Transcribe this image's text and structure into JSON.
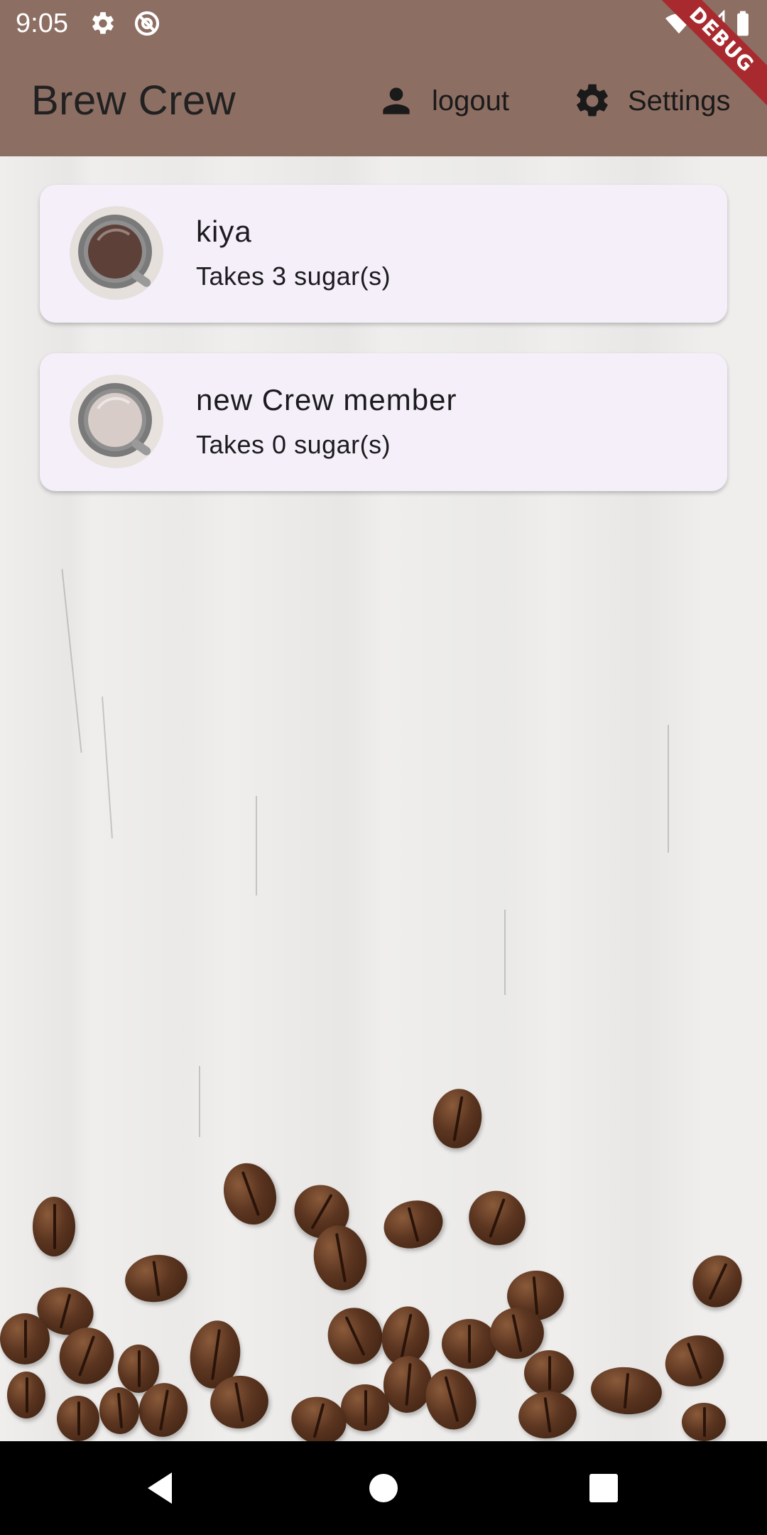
{
  "status_bar": {
    "time": "9:05",
    "icons": [
      "settings-gear-icon",
      "at-sign-icon",
      "wifi-icon",
      "signal-icon",
      "battery-icon"
    ]
  },
  "app_bar": {
    "title": "Brew Crew",
    "logout_label": "logout",
    "settings_label": "Settings",
    "debug_label": "DEBUG",
    "background_color": "#8d6e63"
  },
  "brews": [
    {
      "name": "kiya",
      "subtitle": "Takes 3 sugar(s)",
      "cup_color": "#5d4037",
      "icon": "coffee-cup-icon"
    },
    {
      "name": "new Crew member",
      "subtitle": "Takes 0 sugar(s)",
      "cup_color": "#d7ccc8",
      "icon": "coffee-cup-icon"
    }
  ],
  "nav_bar": {
    "buttons": [
      "back-icon",
      "home-icon",
      "recents-icon"
    ]
  },
  "colors": {
    "card_background": "#f4eff9",
    "text": "#1c1b1f"
  }
}
